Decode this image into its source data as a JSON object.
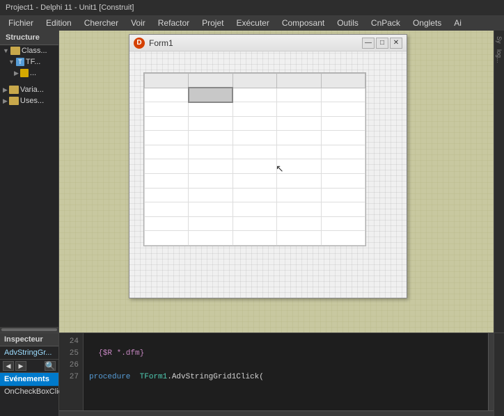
{
  "titlebar": {
    "text": "Project1 - Delphi 11 - Unit1 [Construit]"
  },
  "menubar": {
    "items": [
      {
        "label": "Fichier",
        "id": "fichier"
      },
      {
        "label": "Edition",
        "id": "edition"
      },
      {
        "label": "Chercher",
        "id": "chercher"
      },
      {
        "label": "Voir",
        "id": "voir"
      },
      {
        "label": "Refactor",
        "id": "refactor"
      },
      {
        "label": "Projet",
        "id": "projet"
      },
      {
        "label": "Exécuter",
        "id": "executer"
      },
      {
        "label": "Composant",
        "id": "composant"
      },
      {
        "label": "Outils",
        "id": "outils"
      },
      {
        "label": "CnPack",
        "id": "cnpack"
      },
      {
        "label": "Onglets",
        "id": "onglets"
      },
      {
        "label": "Ai",
        "id": "ai"
      }
    ]
  },
  "structure": {
    "label": "Structure",
    "items": [
      {
        "level": 1,
        "label": "Class...",
        "icon": "folder"
      },
      {
        "level": 2,
        "label": "TF...",
        "icon": "class"
      },
      {
        "level": 3,
        "label": "...",
        "icon": "field"
      }
    ]
  },
  "form1": {
    "title": "Form1",
    "icon": "D",
    "minimize": "—",
    "maximize": "□",
    "close": "✕"
  },
  "inspector": {
    "label": "Inspecteur",
    "component": "AdvStringGr...",
    "tabs": {
      "events": "Evénements"
    },
    "events": [
      {
        "name": "OnCheckBoxClick"
      }
    ]
  },
  "code": {
    "lines": [
      {
        "num": "24",
        "content": "",
        "tokens": []
      },
      {
        "num": "25",
        "content": "  {$R *.dfm}",
        "type": "directive"
      },
      {
        "num": "26",
        "content": "",
        "tokens": []
      },
      {
        "num": "27",
        "content": "procedure TForm1.AdvStringGrid1Click(",
        "type": "mixed"
      }
    ]
  },
  "right_panel": {
    "text1": "Sy",
    "text2": "log..."
  },
  "grid": {
    "rows": 12,
    "cols": 5,
    "selected_row": 1,
    "selected_col": 1
  }
}
